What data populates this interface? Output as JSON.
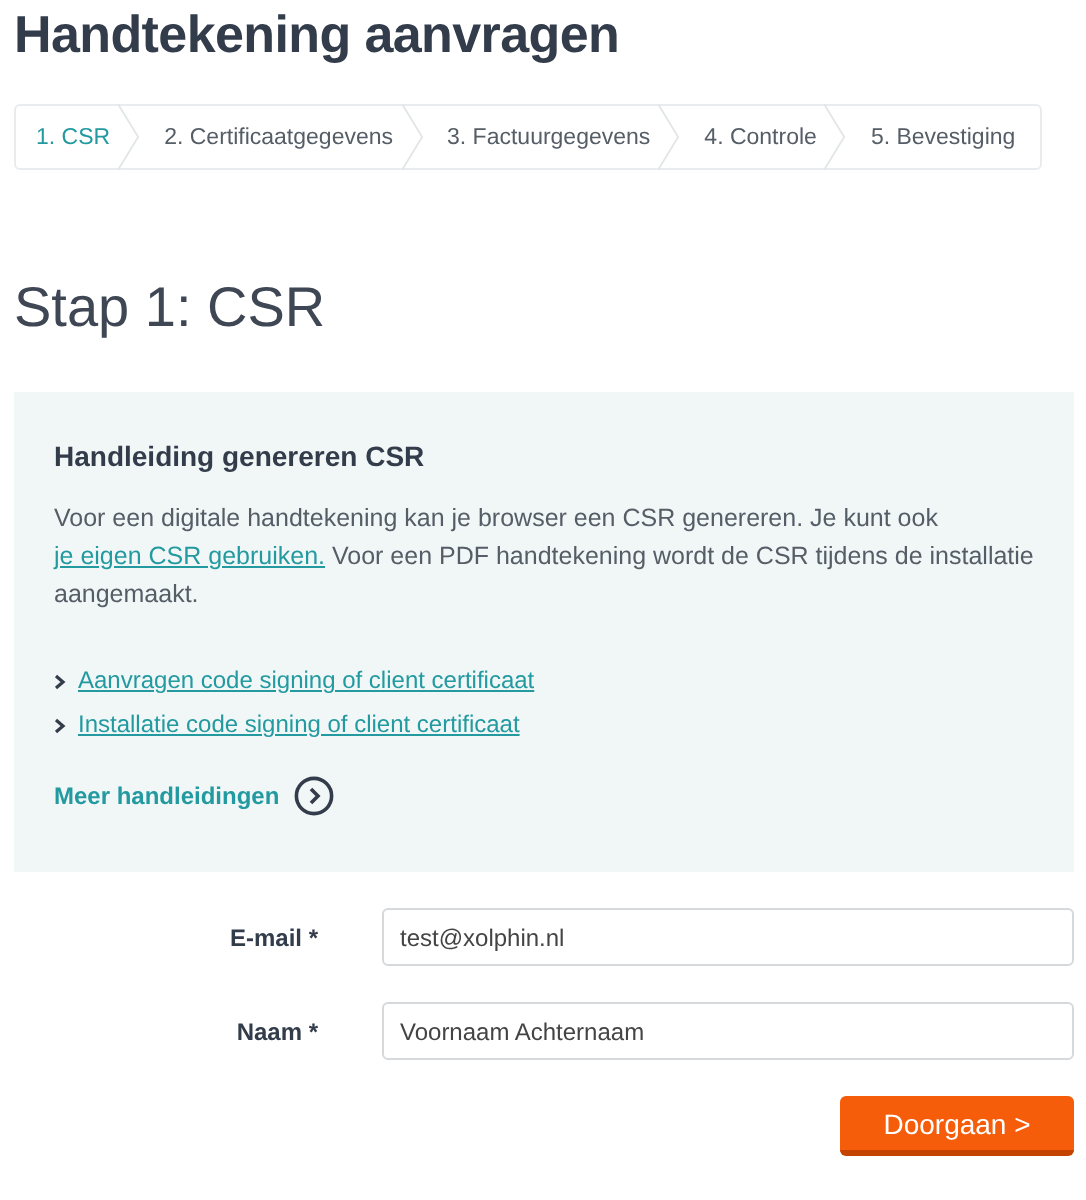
{
  "title": "Handtekening aanvragen",
  "steps": [
    {
      "label": "1. CSR",
      "selected": true
    },
    {
      "label": "2. Certificaatgegevens",
      "selected": false
    },
    {
      "label": "3. Factuurgegevens",
      "selected": false
    },
    {
      "label": "4. Controle",
      "selected": false
    },
    {
      "label": "5. Bevestiging",
      "selected": false
    }
  ],
  "step_heading": "Stap 1: CSR",
  "guide": {
    "title": "Handleiding genereren CSR",
    "text_before": "Voor een digitale handtekening kan je browser een CSR genereren. Je kunt ook ",
    "link": "je eigen CSR gebruiken.",
    "text_after": " Voor een PDF handtekening wordt de CSR tijdens de installatie aangemaakt.",
    "links": [
      "Aanvragen code signing of client certificaat",
      "Installatie code signing of client certificaat"
    ],
    "more": "Meer handleidingen"
  },
  "fields": [
    {
      "label": "E-mail *",
      "value": "test@xolphin.nl"
    },
    {
      "label": "Naam *",
      "value": "Voornaam Achternaam"
    }
  ],
  "submit": "Doorgaan >"
}
